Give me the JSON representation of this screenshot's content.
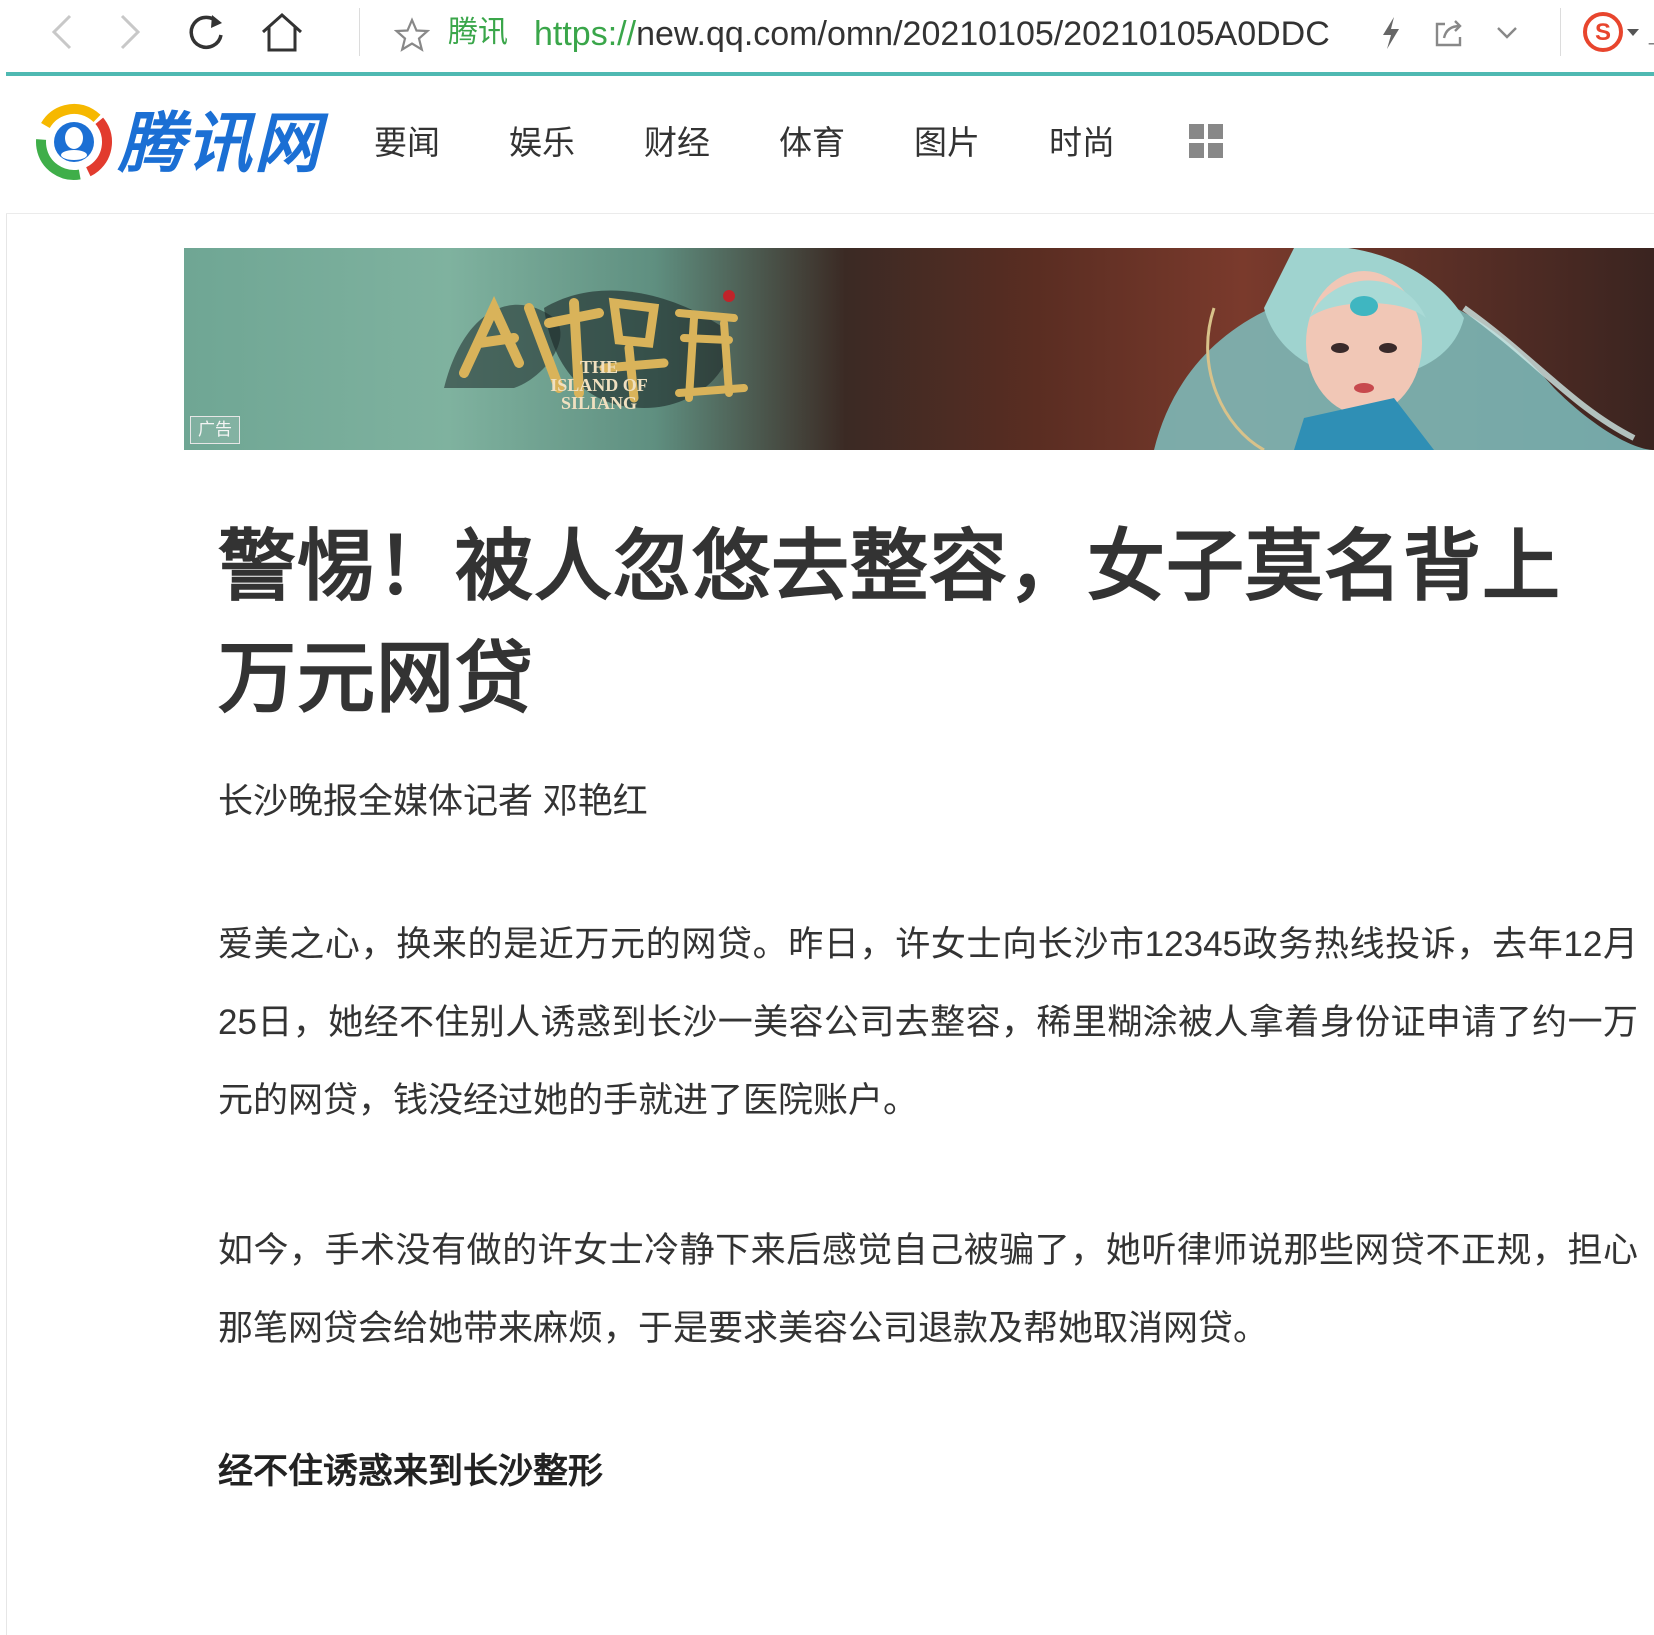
{
  "browser": {
    "site_label": "腾讯",
    "url_scheme": "https://",
    "url_rest": "new.qq.com/omn/20210105/20210105A0DDC",
    "edge_mark": "_"
  },
  "site": {
    "logo_text": "腾讯网",
    "nav": [
      "要闻",
      "娱乐",
      "财经",
      "体育",
      "图片",
      "时尚"
    ],
    "brand_color": "#1b6fd4"
  },
  "ad": {
    "title_en_1": "THE",
    "title_en_2": "ISLAND OF",
    "title_en_3": "SILIANG",
    "badge": "广告"
  },
  "article": {
    "title": "警惕！被人忽悠去整容，女子莫名背上万元网贷",
    "byline": "长沙晚报全媒体记者 邓艳红",
    "paragraphs": [
      "爱美之心，换来的是近万元的网贷。昨日，许女士向长沙市12345政务热线投诉，去年12月25日，她经不住别人诱惑到长沙一美容公司去整容，稀里糊涂被人拿着身份证申请了约一万元的网贷，钱没经过她的手就进了医院账户。",
      "如今，手术没有做的许女士冷静下来后感觉自己被骗了，她听律师说那些网贷不正规，担心那笔网贷会给她带来麻烦，于是要求美容公司退款及帮她取消网贷。"
    ],
    "subhead": "经不住诱惑来到长沙整形"
  }
}
